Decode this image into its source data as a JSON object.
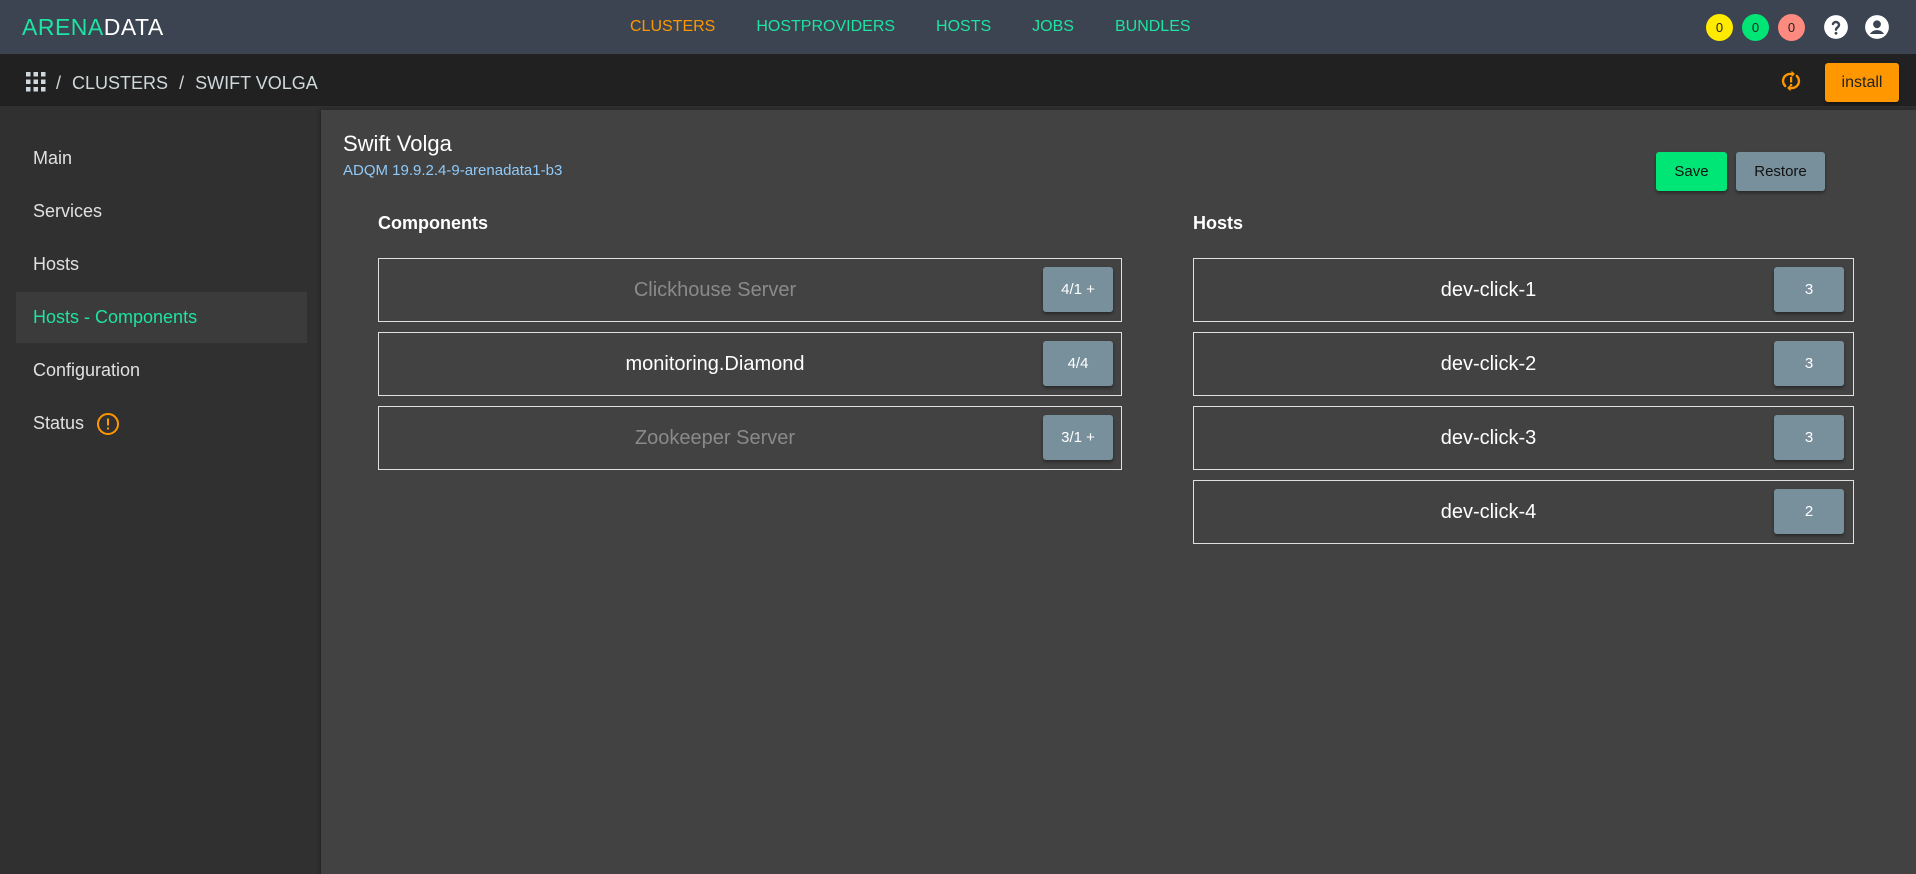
{
  "logo": {
    "part1": "ARENA",
    "part2": "DATA"
  },
  "nav": [
    {
      "label": "CLUSTERS",
      "active": true
    },
    {
      "label": "HOSTPROVIDERS",
      "active": false
    },
    {
      "label": "HOSTS",
      "active": false
    },
    {
      "label": "JOBS",
      "active": false
    },
    {
      "label": "BUNDLES",
      "active": false
    }
  ],
  "badges": [
    {
      "value": "0",
      "color": "#ffea00"
    },
    {
      "value": "0",
      "color": "#00e676"
    },
    {
      "value": "0",
      "color": "#ff8a80"
    }
  ],
  "icons": {
    "help": "help-circle-icon",
    "account": "account-circle-icon",
    "apps": "apps-grid-icon",
    "sync": "sync-icon",
    "status": "alert-circle-icon"
  },
  "breadcrumb": {
    "sep": "/",
    "items": [
      "CLUSTERS",
      "SWIFT VOLGA"
    ]
  },
  "toolbar": {
    "install_label": "install"
  },
  "sidebar": {
    "items": [
      {
        "label": "Main"
      },
      {
        "label": "Services"
      },
      {
        "label": "Hosts"
      },
      {
        "label": "Hosts - Components",
        "active": true
      },
      {
        "label": "Configuration"
      },
      {
        "label": "Status"
      }
    ]
  },
  "main": {
    "title": "Swift Volga",
    "subtitle": "ADQM 19.9.2.4-9-arenadata1-b3",
    "save_label": "Save",
    "restore_label": "Restore",
    "components_heading": "Components",
    "hosts_heading": "Hosts",
    "components": [
      {
        "name": "Clickhouse Server",
        "count": "4/1 +",
        "dim": true
      },
      {
        "name": "monitoring.Diamond",
        "count": "4/4",
        "dim": false
      },
      {
        "name": "Zookeeper Server",
        "count": "3/1 +",
        "dim": true
      }
    ],
    "hosts": [
      {
        "name": "dev-click-1",
        "count": "3"
      },
      {
        "name": "dev-click-2",
        "count": "3"
      },
      {
        "name": "dev-click-3",
        "count": "3"
      },
      {
        "name": "dev-click-4",
        "count": "2"
      }
    ]
  },
  "colors": {
    "accent": "#1ee3a2",
    "active_nav": "#ff9800",
    "topbar": "#3b4450"
  }
}
